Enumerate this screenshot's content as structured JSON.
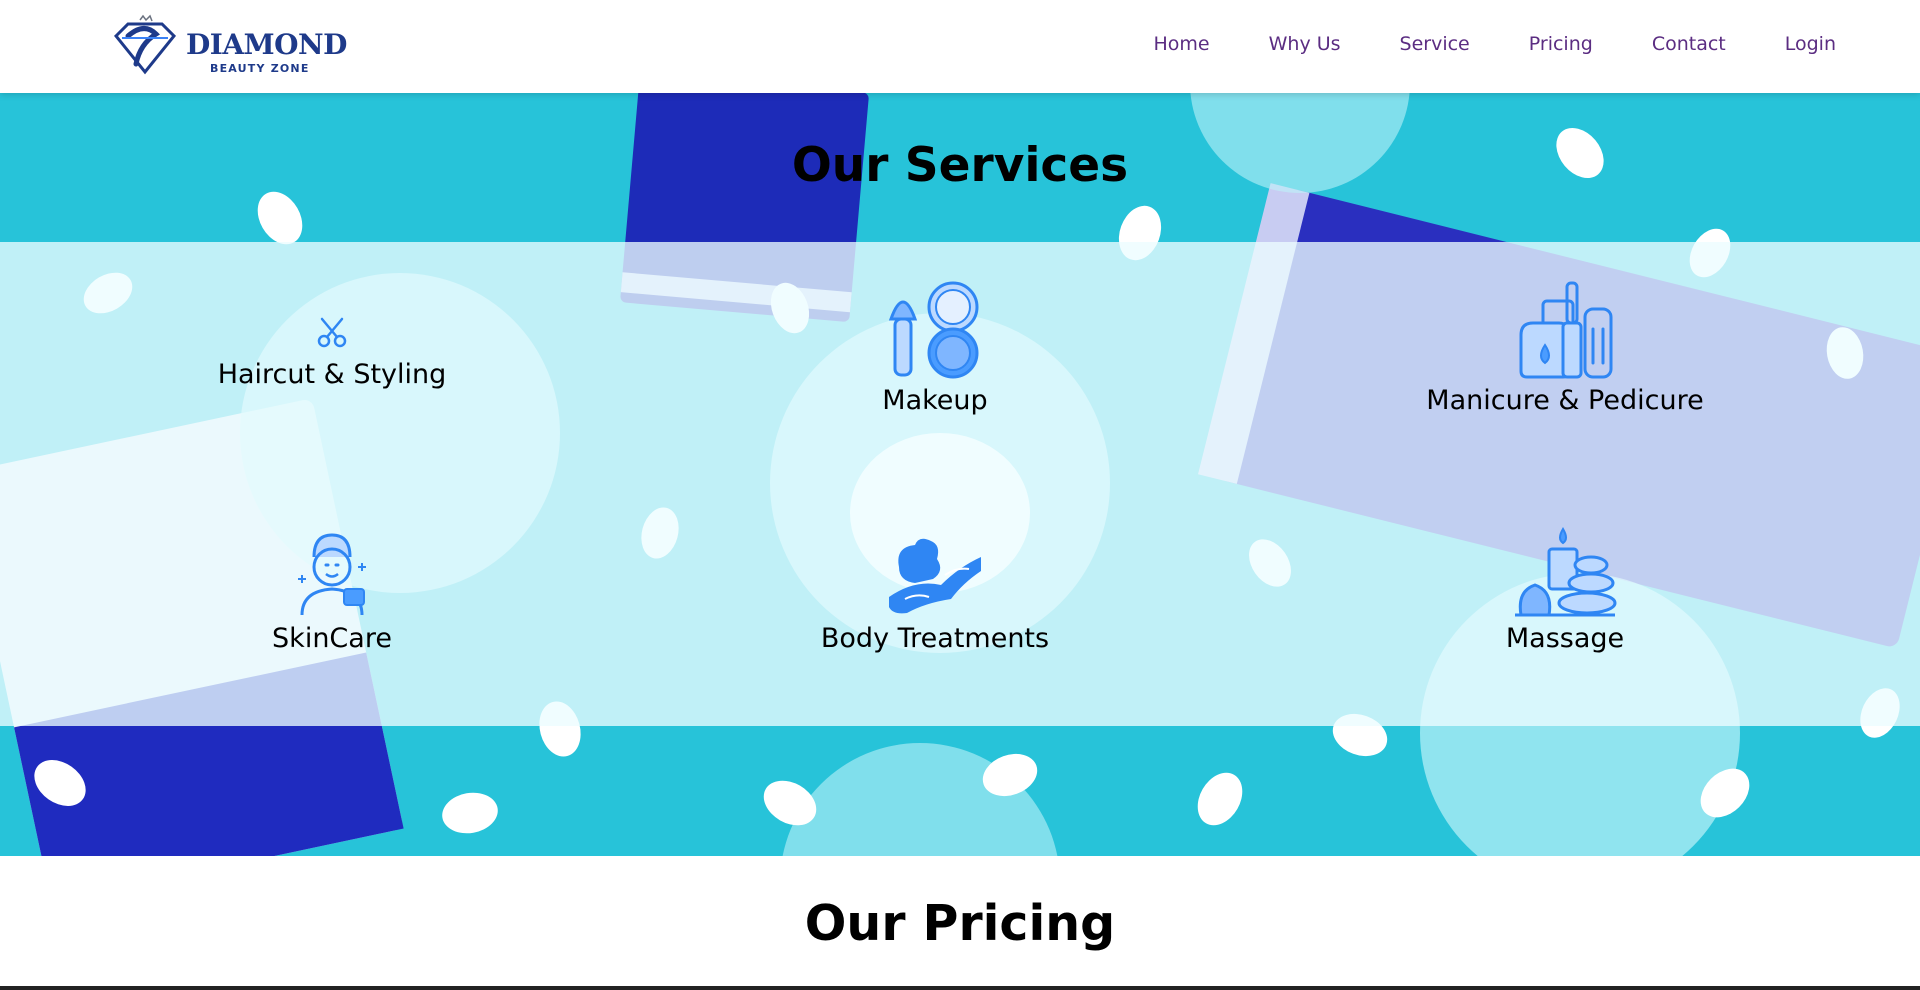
{
  "brand": {
    "title": "DIAMOND",
    "subtitle": "BEAUTY ZONE",
    "icon": "diamond-logo-icon"
  },
  "nav": {
    "items": [
      {
        "label": "Home"
      },
      {
        "label": "Why Us"
      },
      {
        "label": "Service"
      },
      {
        "label": "Pricing"
      },
      {
        "label": "Contact"
      },
      {
        "label": "Login"
      }
    ]
  },
  "services": {
    "title": "Our Services",
    "items": [
      {
        "label": "Haircut & Styling",
        "icon": "scissors-icon"
      },
      {
        "label": "Makeup",
        "icon": "makeup-brush-compact-icon"
      },
      {
        "label": "Manicure & Pedicure",
        "icon": "nail-polish-icon"
      },
      {
        "label": "SkinCare",
        "icon": "face-mask-icon"
      },
      {
        "label": "Body Treatments",
        "icon": "body-treatment-icon"
      },
      {
        "label": "Massage",
        "icon": "spa-stones-candle-icon"
      }
    ]
  },
  "pricing": {
    "title": "Our Pricing"
  },
  "colors": {
    "nav_text": "#5b2d82",
    "brand": "#1e3a8a",
    "icon_blue": "#2f86f3",
    "hero_bg": "#27c3d9",
    "overlay": "rgba(236,252,255,0.78)"
  }
}
